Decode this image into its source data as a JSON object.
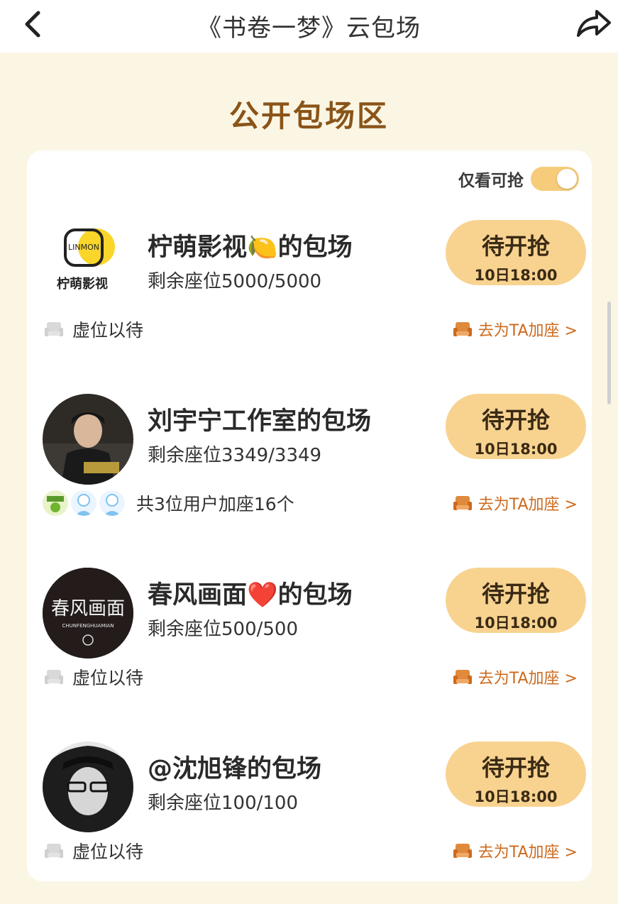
{
  "header": {
    "title": "《书卷一梦》云包场",
    "back_icon": "chevron-left-icon",
    "share_icon": "share-arrow-icon"
  },
  "section_title": "公开包场区",
  "filter": {
    "label": "仅看可抢",
    "enabled": true
  },
  "colors": {
    "accent": "#f8d390",
    "title": "#8a5419",
    "link": "#cc6a1e",
    "background": "#fbf6e4"
  },
  "items": [
    {
      "host": "柠萌影视🍋的包场",
      "seats": "剩余座位5000/5000",
      "button": "待开抢",
      "time": "10日18:00",
      "footer_left": "虚位以待",
      "footer_right": "去为TA加座 >",
      "logo_text": "LINMON",
      "logo_caption": "柠萌影视"
    },
    {
      "host": "刘宇宁工作室的包场",
      "seats": "剩余座位3349/3349",
      "button": "待开抢",
      "time": "10日18:00",
      "footer_left": "共3位用户加座16个",
      "footer_right": "去为TA加座 >"
    },
    {
      "host": "春风画面❤️的包场",
      "seats": "剩余座位500/500",
      "button": "待开抢",
      "time": "10日18:00",
      "footer_left": "虚位以待",
      "footer_right": "去为TA加座 >",
      "logo_text": "春风画面",
      "logo_caption": "CHUNFENGHUAMIAN"
    },
    {
      "host": "@沈旭锋的包场",
      "seats": "剩余座位100/100",
      "button": "待开抢",
      "time": "10日18:00",
      "footer_left": "虚位以待",
      "footer_right": "去为TA加座 >"
    }
  ]
}
